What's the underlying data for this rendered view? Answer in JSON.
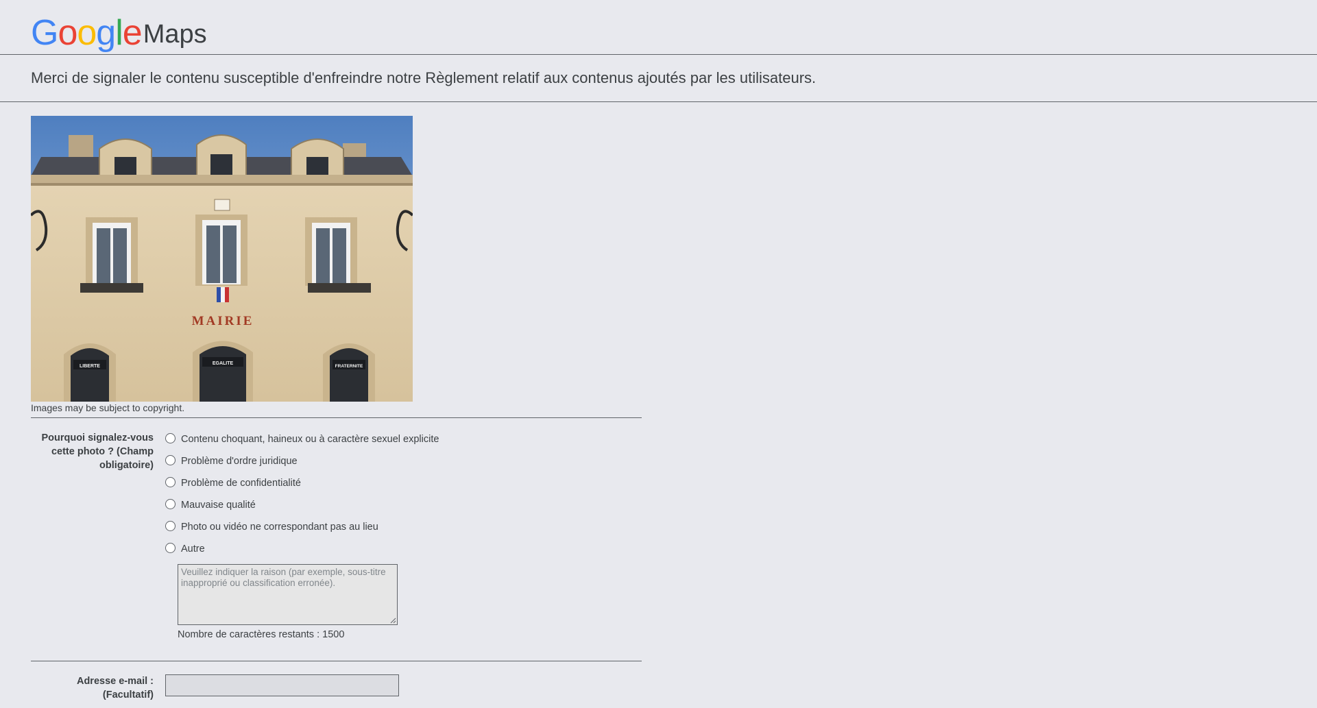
{
  "logo": {
    "letters": [
      "G",
      "o",
      "o",
      "g",
      "l",
      "e"
    ],
    "product": "Maps"
  },
  "intro": "Merci de signaler le contenu susceptible d'enfreindre notre Règlement relatif aux contenus ajoutés par les utilisateurs.",
  "photo": {
    "sign_text": "MAIRIE",
    "panel_left": "LIBERTE",
    "panel_center": "EGALITE",
    "panel_right": "FRATERNITE"
  },
  "copyright": "Images may be subject to copyright.",
  "form": {
    "why_label": [
      "Pourquoi signalez-vous",
      "cette photo ? (Champ",
      "obligatoire)"
    ],
    "options": [
      "Contenu choquant, haineux ou à caractère sexuel explicite",
      "Problème d'ordre juridique",
      "Problème de confidentialité",
      "Mauvaise qualité",
      "Photo ou vidéo ne correspondant pas au lieu",
      "Autre"
    ],
    "reason_placeholder": "Veuillez indiquer la raison (par exemple, sous-titre inapproprié ou classification erronée).",
    "remaining_label": "Nombre de caractères restants : 1500",
    "email_label": [
      "Adresse e-mail :",
      "(Facultatif)"
    ],
    "email_value": ""
  },
  "colors": {
    "background": "#e8e9ee",
    "google_blue": "#4285f4",
    "google_red": "#ea4335",
    "google_yellow": "#fbbc05",
    "google_green": "#34a853"
  }
}
